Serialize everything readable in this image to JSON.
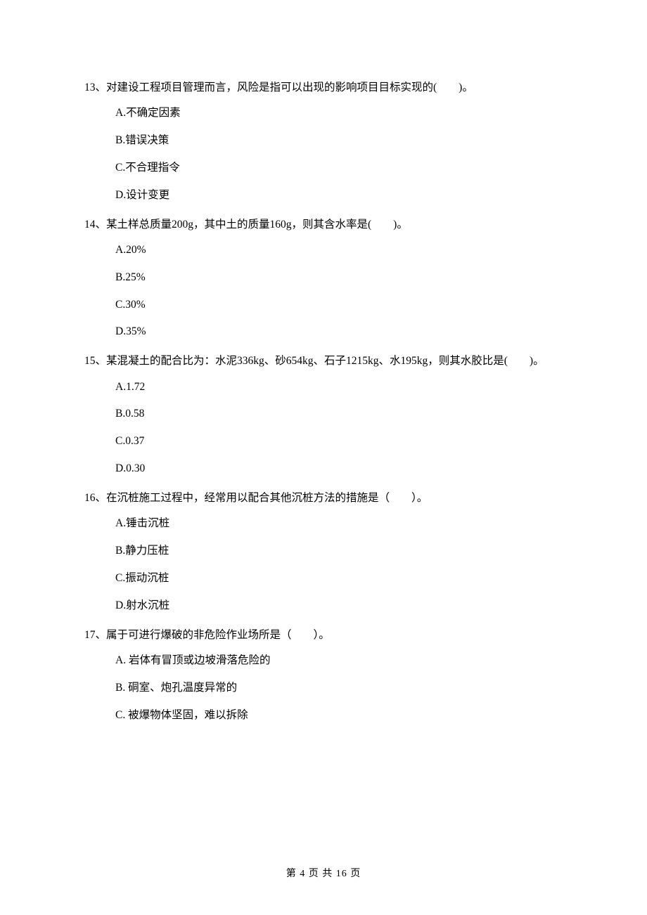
{
  "questions": [
    {
      "num": "13、",
      "text": "对建设工程项目管理而言，风险是指可以出现的影响项目目标实现的(　　)。",
      "options": [
        "A.不确定因素",
        "B.错误决策",
        "C.不合理指令",
        "D.设计变更"
      ]
    },
    {
      "num": "14、",
      "text": "某土样总质量200g，其中土的质量160g，则其含水率是(　　)。",
      "options": [
        "A.20%",
        "B.25%",
        "C.30%",
        "D.35%"
      ]
    },
    {
      "num": "15、",
      "text": "某混凝土的配合比为：水泥336kg、砂654kg、石子1215kg、水195kg，则其水胶比是(　　)。",
      "options": [
        "A.1.72",
        "B.0.58",
        "C.0.37",
        "D.0.30"
      ]
    },
    {
      "num": "16、",
      "text": "在沉桩施工过程中，经常用以配合其他沉桩方法的措施是（　　）。",
      "options": [
        "A.锤击沉桩",
        "B.静力压桩",
        "C.振动沉桩",
        "D.射水沉桩"
      ]
    },
    {
      "num": "17、",
      "text": "属于可进行爆破的非危险作业场所是（　　）。",
      "options": [
        "A. 岩体有冒顶或边坡滑落危险的",
        "B. 硐室、炮孔温度异常的",
        "C. 被爆物体坚固，难以拆除"
      ]
    }
  ],
  "footer": "第 4 页 共 16 页"
}
